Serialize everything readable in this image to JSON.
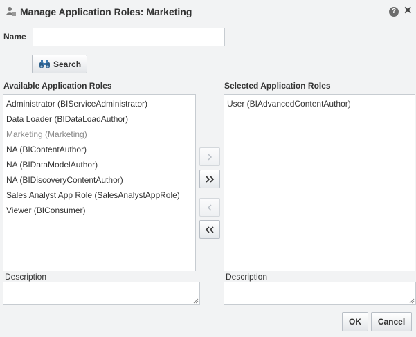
{
  "dialog": {
    "title": "Manage Application Roles: Marketing",
    "help_icon": "help-icon",
    "close_icon": "close-icon",
    "title_icon": "roles-icon"
  },
  "search": {
    "name_label": "Name",
    "name_value": "",
    "button_label": "Search",
    "button_icon": "binoculars-icon"
  },
  "available": {
    "heading": "Available Application Roles",
    "items": [
      {
        "label": "Administrator (BIServiceAdministrator)",
        "disabled": false
      },
      {
        "label": "Data Loader (BIDataLoadAuthor)",
        "disabled": false
      },
      {
        "label": "Marketing (Marketing)",
        "disabled": true
      },
      {
        "label": "NA (BIContentAuthor)",
        "disabled": false
      },
      {
        "label": "NA (BIDataModelAuthor)",
        "disabled": false
      },
      {
        "label": "NA (BIDiscoveryContentAuthor)",
        "disabled": false
      },
      {
        "label": "Sales Analyst App Role (SalesAnalystAppRole)",
        "disabled": false
      },
      {
        "label": "Viewer (BIConsumer)",
        "disabled": false
      }
    ],
    "description_label": "Description",
    "description_value": ""
  },
  "selected": {
    "heading": "Selected Application Roles",
    "items": [
      {
        "label": "User (BIAdvancedContentAuthor)",
        "disabled": false
      }
    ],
    "description_label": "Description",
    "description_value": ""
  },
  "shuttle": {
    "move_icon": "chevron-right-icon",
    "move_all_icon": "double-chevron-right-icon",
    "remove_icon": "chevron-left-icon",
    "remove_all_icon": "double-chevron-left-icon"
  },
  "footer": {
    "ok_label": "OK",
    "cancel_label": "Cancel"
  },
  "colors": {
    "background": "#f2f3f4",
    "border": "#c7ccd1",
    "text": "#333333",
    "disabled_text": "#888888"
  }
}
